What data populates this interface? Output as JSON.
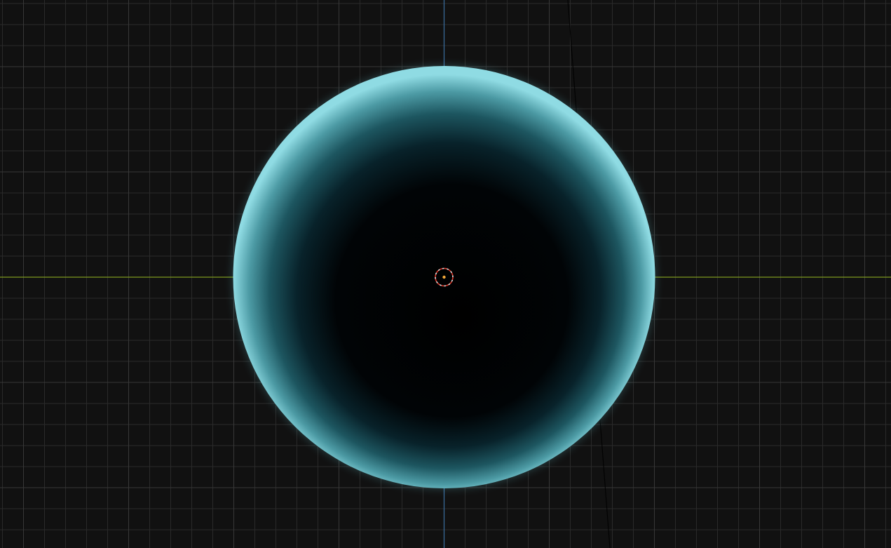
{
  "viewport": {
    "background": "#111111",
    "grid_minor_color": "#2a2a2a",
    "grid_major_color": "#383838",
    "x_axis_color": "#7d9a1f",
    "y_axis_color": "#3b6fa0"
  },
  "object": {
    "type": "sphere",
    "shading": "fresnel-rim",
    "rim_color": "#7fd3dc",
    "core_color": "#000000"
  },
  "origin_marker": {
    "ring_color": "#e0392b",
    "dot_color": "#f2a83a"
  },
  "icons": {
    "origin": "origin-marker-icon"
  }
}
